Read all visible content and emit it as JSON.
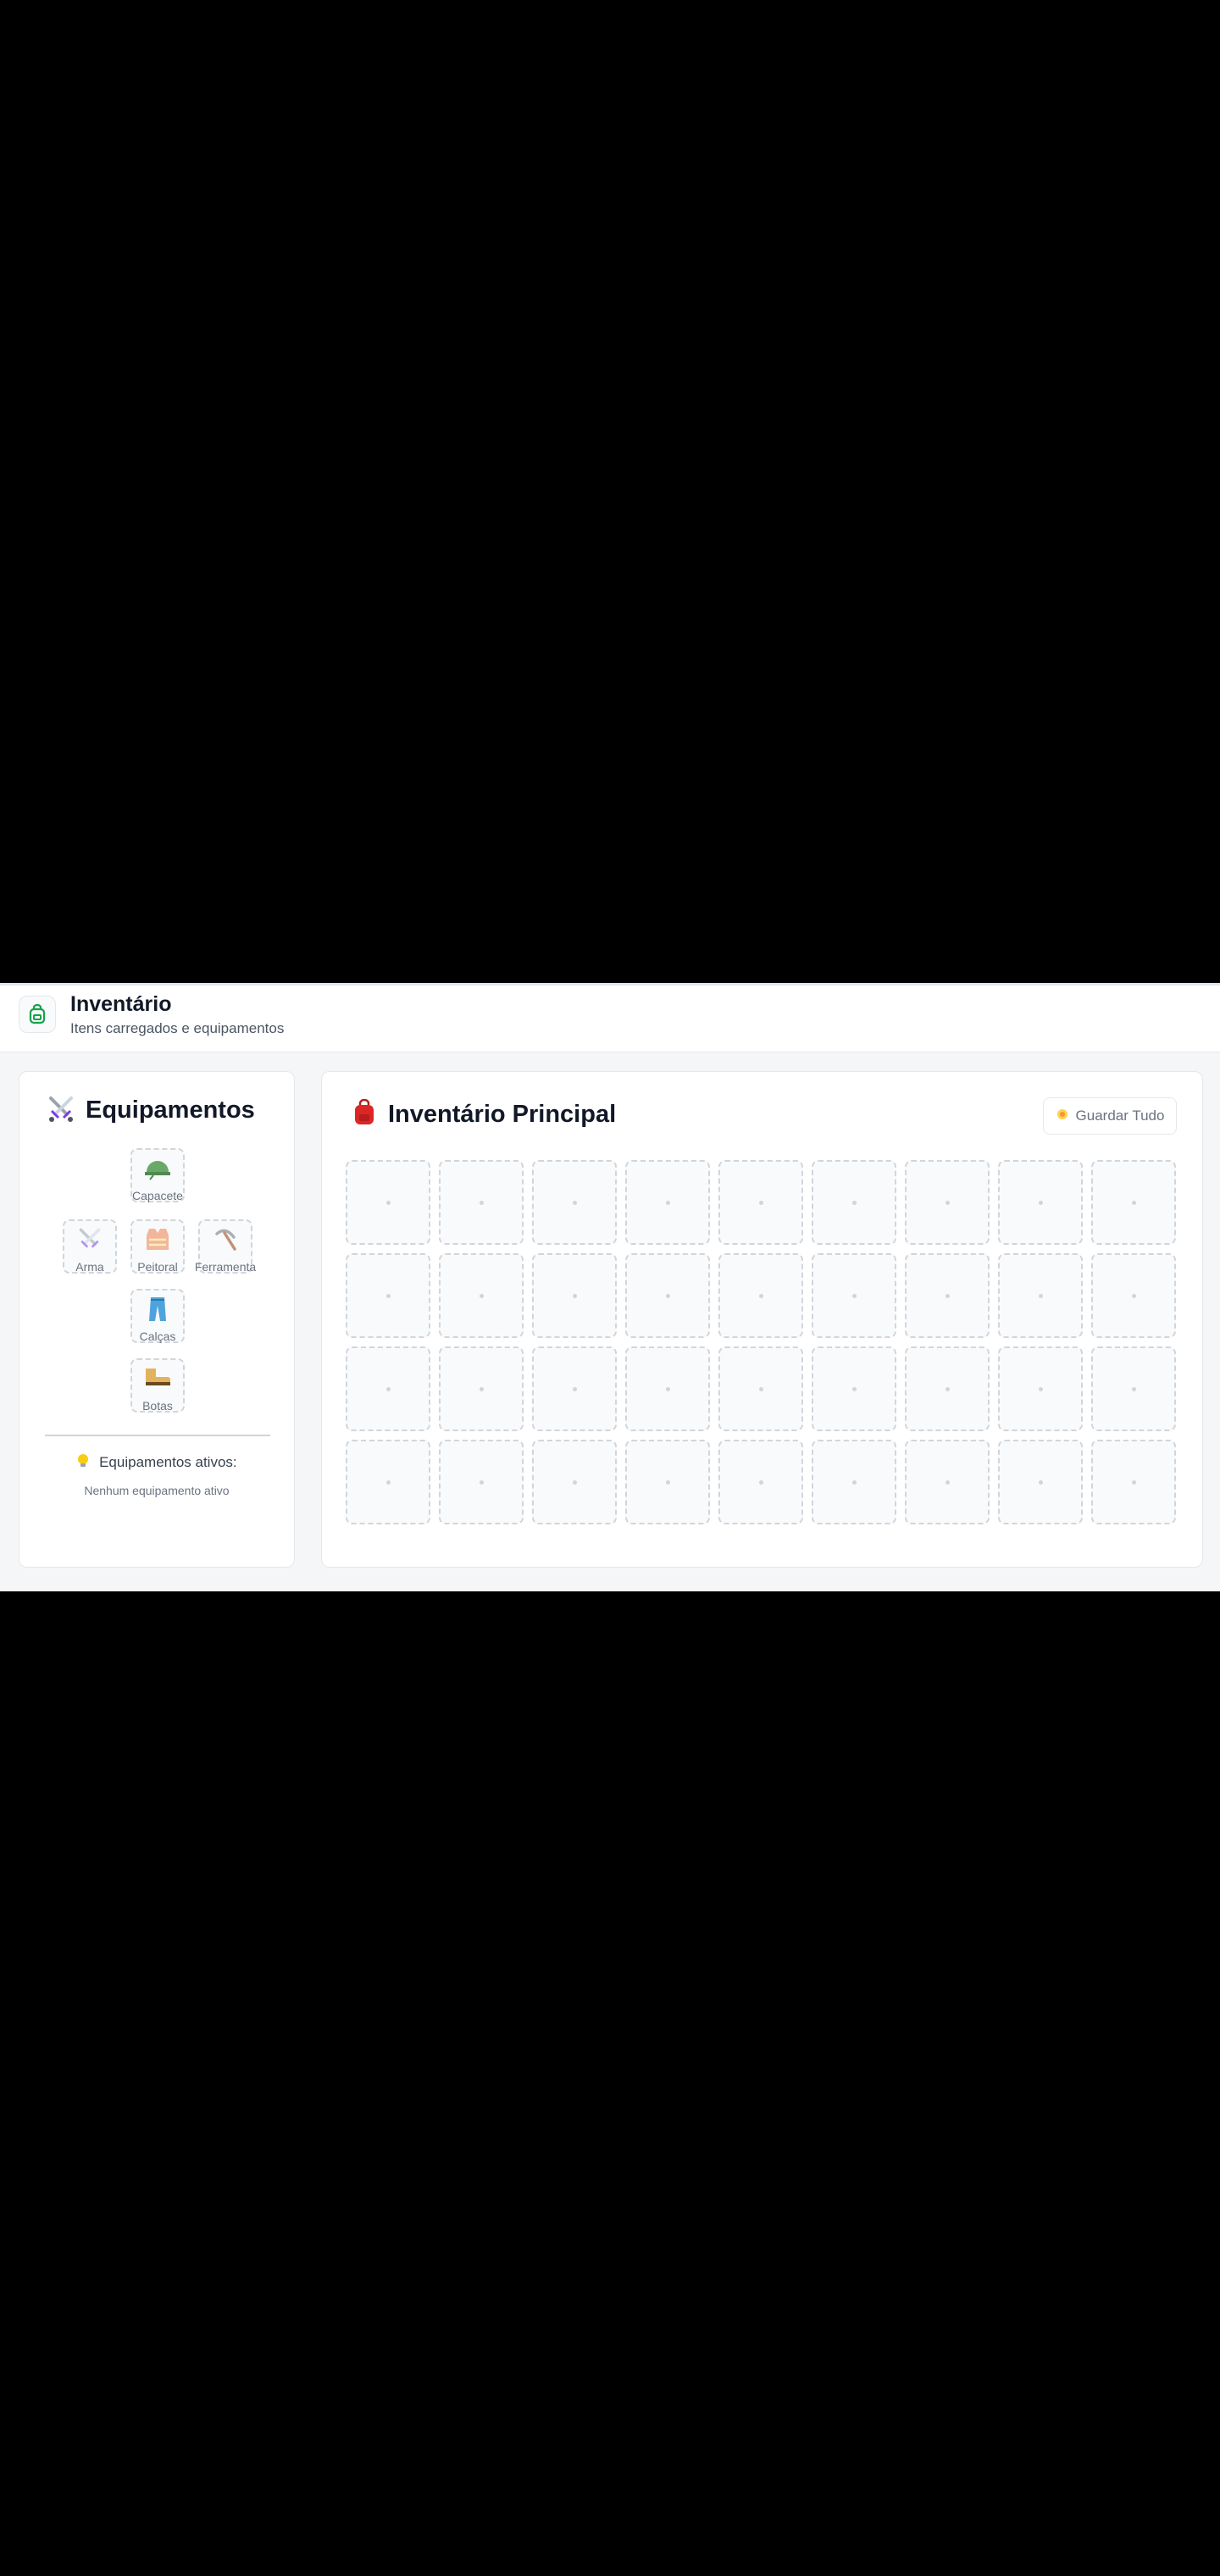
{
  "header": {
    "title": "Inventário",
    "subtitle": "Itens carregados e equipamentos",
    "icon": "backpack-icon"
  },
  "equipment": {
    "title": "Equipamentos",
    "icon": "crossed-swords-icon",
    "slots": {
      "helmet": {
        "label": "Capacete",
        "icon": "helmet-icon"
      },
      "weapon": {
        "label": "Arma",
        "icon": "crossed-swords-icon"
      },
      "chest": {
        "label": "Peitoral",
        "icon": "vest-icon"
      },
      "tool": {
        "label": "Ferramenta",
        "icon": "pickaxe-icon"
      },
      "pants": {
        "label": "Calças",
        "icon": "jeans-icon"
      },
      "boots": {
        "label": "Botas",
        "icon": "boots-icon"
      }
    },
    "active_title": "Equipamentos ativos:",
    "active_icon": "lightbulb-icon",
    "active_empty": "Nenhum equipamento ativo"
  },
  "inventory": {
    "title": "Inventário Principal",
    "icon": "red-backpack-icon",
    "store_button": {
      "label": "Guardar Tudo",
      "icon": "sparkle-icon"
    },
    "grid": {
      "columns": 9,
      "rows": 4,
      "filled_slots": 0
    }
  },
  "colors": {
    "accent_green": "#16a34a",
    "backpack_red": "#dc2626",
    "slot_border": "#d1d5db"
  }
}
